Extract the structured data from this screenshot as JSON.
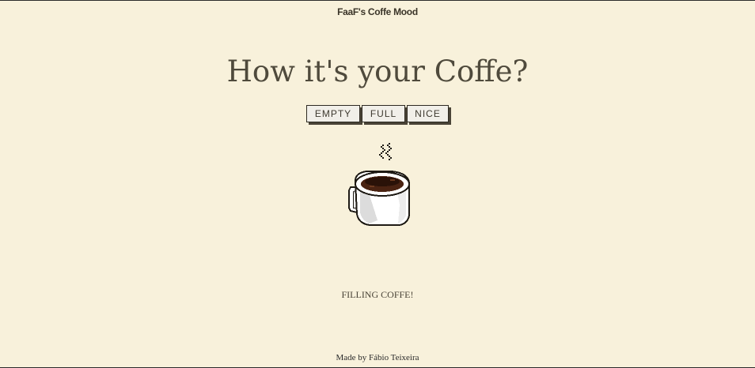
{
  "header": {
    "brand": "FaaF's Coffe Mood"
  },
  "main": {
    "title": "How it's your Coffe?",
    "buttons": [
      {
        "label": "EMPTY"
      },
      {
        "label": "FULL"
      },
      {
        "label": "NICE"
      }
    ],
    "status": "FILLING COFFE!"
  },
  "footer": {
    "credit": "Made by Fábio Teixeira"
  },
  "colors": {
    "background": "#f8f1db",
    "text": "#4a4437",
    "coffee": "#4a2312",
    "cup": "#ffffff"
  },
  "icons": {
    "illustration": "coffee-cup-icon",
    "steam": "steam-icon"
  }
}
